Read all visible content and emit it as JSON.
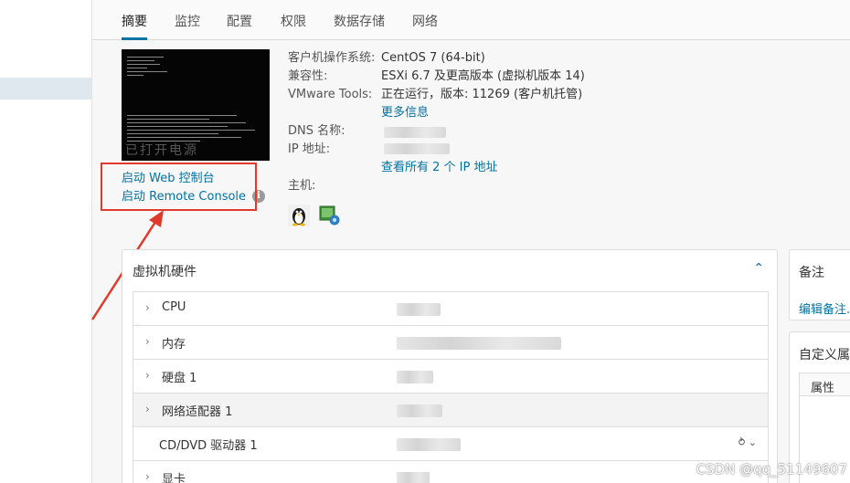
{
  "tabs": [
    {
      "label": "摘要"
    },
    {
      "label": "监控"
    },
    {
      "label": "配置"
    },
    {
      "label": "权限"
    },
    {
      "label": "数据存储"
    },
    {
      "label": "网络"
    }
  ],
  "console": {
    "thumbnail_overlay": "已打开电源",
    "web_console_link": "启动 Web 控制台",
    "remote_console_link": "启动 Remote Console"
  },
  "summary": {
    "guest_os_label": "客户机操作系统:",
    "guest_os_value": "CentOS 7 (64-bit)",
    "compat_label": "兼容性:",
    "compat_value": "ESXi 6.7 及更高版本 (虚拟机版本 14)",
    "tools_label": "VMware Tools:",
    "tools_value": "正在运行，版本: 11269 (客户机托管)",
    "more_info_link": "更多信息",
    "dns_label": "DNS 名称:",
    "ip_label": "IP 地址:",
    "view_all_ip_link": "查看所有 2 个 IP 地址",
    "host_label": "主机:"
  },
  "hardware": {
    "title": "虚拟机硬件",
    "rows": [
      {
        "name": "CPU"
      },
      {
        "name": "内存"
      },
      {
        "name": "硬盘 1"
      },
      {
        "name": "网络适配器 1"
      },
      {
        "name": "CD/DVD 驱动器 1"
      },
      {
        "name": "显卡"
      }
    ]
  },
  "notes": {
    "title": "备注",
    "edit_link": "编辑备注..."
  },
  "custom_attrs": {
    "title": "自定义属性",
    "column_header": "属性"
  },
  "icons": [
    "info-icon",
    "linux-penguin-icon",
    "vm-host-icon",
    "chevron-up-icon",
    "chevron-right-icon",
    "connect-device-icon"
  ],
  "colors": {
    "accent": "#0072a3",
    "highlight_box": "#e03a2d"
  },
  "watermark": "CSDN @qq_51149607"
}
